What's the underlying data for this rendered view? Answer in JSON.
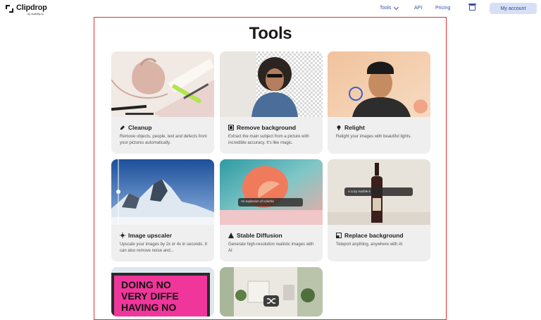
{
  "header": {
    "logo_title": "Clipdrop",
    "logo_sub": "by stability.ai",
    "nav_tools": "Tools",
    "nav_api": "API",
    "nav_pricing": "Pricing",
    "account_label": "My account"
  },
  "page": {
    "title": "Tools"
  },
  "cards": [
    {
      "title": "Cleanup",
      "desc": "Remove objects, people, text and defects from your pictures automatically."
    },
    {
      "title": "Remove background",
      "desc": "Extract the main subject from a picture with incredible accuracy. It's like magic."
    },
    {
      "title": "Relight",
      "desc": "Relight your images with beautiful lights."
    },
    {
      "title": "Image upscaler",
      "desc": "Upscale your images by 2x or 4x in seconds. It can also remove noise and..."
    },
    {
      "title": "Stable Diffusion",
      "desc": "Generate high-resolution realistic images with AI"
    },
    {
      "title": "Replace background",
      "desc": "Teleport anything, anywhere with AI"
    }
  ],
  "image_text": {
    "sd_prompt": "An explosion of colorful",
    "rb_prompt": "A cozy marble k",
    "sign_line1": "DOING NO",
    "sign_line2": "VERY DIFFE",
    "sign_line3": "HAVING NO"
  },
  "colors": {
    "accent": "#3b4ea8",
    "frame": "#e03131",
    "account_bg": "#d8e0f7",
    "card_bg": "#efefef"
  },
  "icons": [
    "clipdrop-logo-icon",
    "chevron-down-icon",
    "archive-icon",
    "eraser-icon",
    "scissors-icon",
    "bulb-icon",
    "upscale-icon",
    "diffusion-icon",
    "replace-icon",
    "shuffle-icon"
  ]
}
